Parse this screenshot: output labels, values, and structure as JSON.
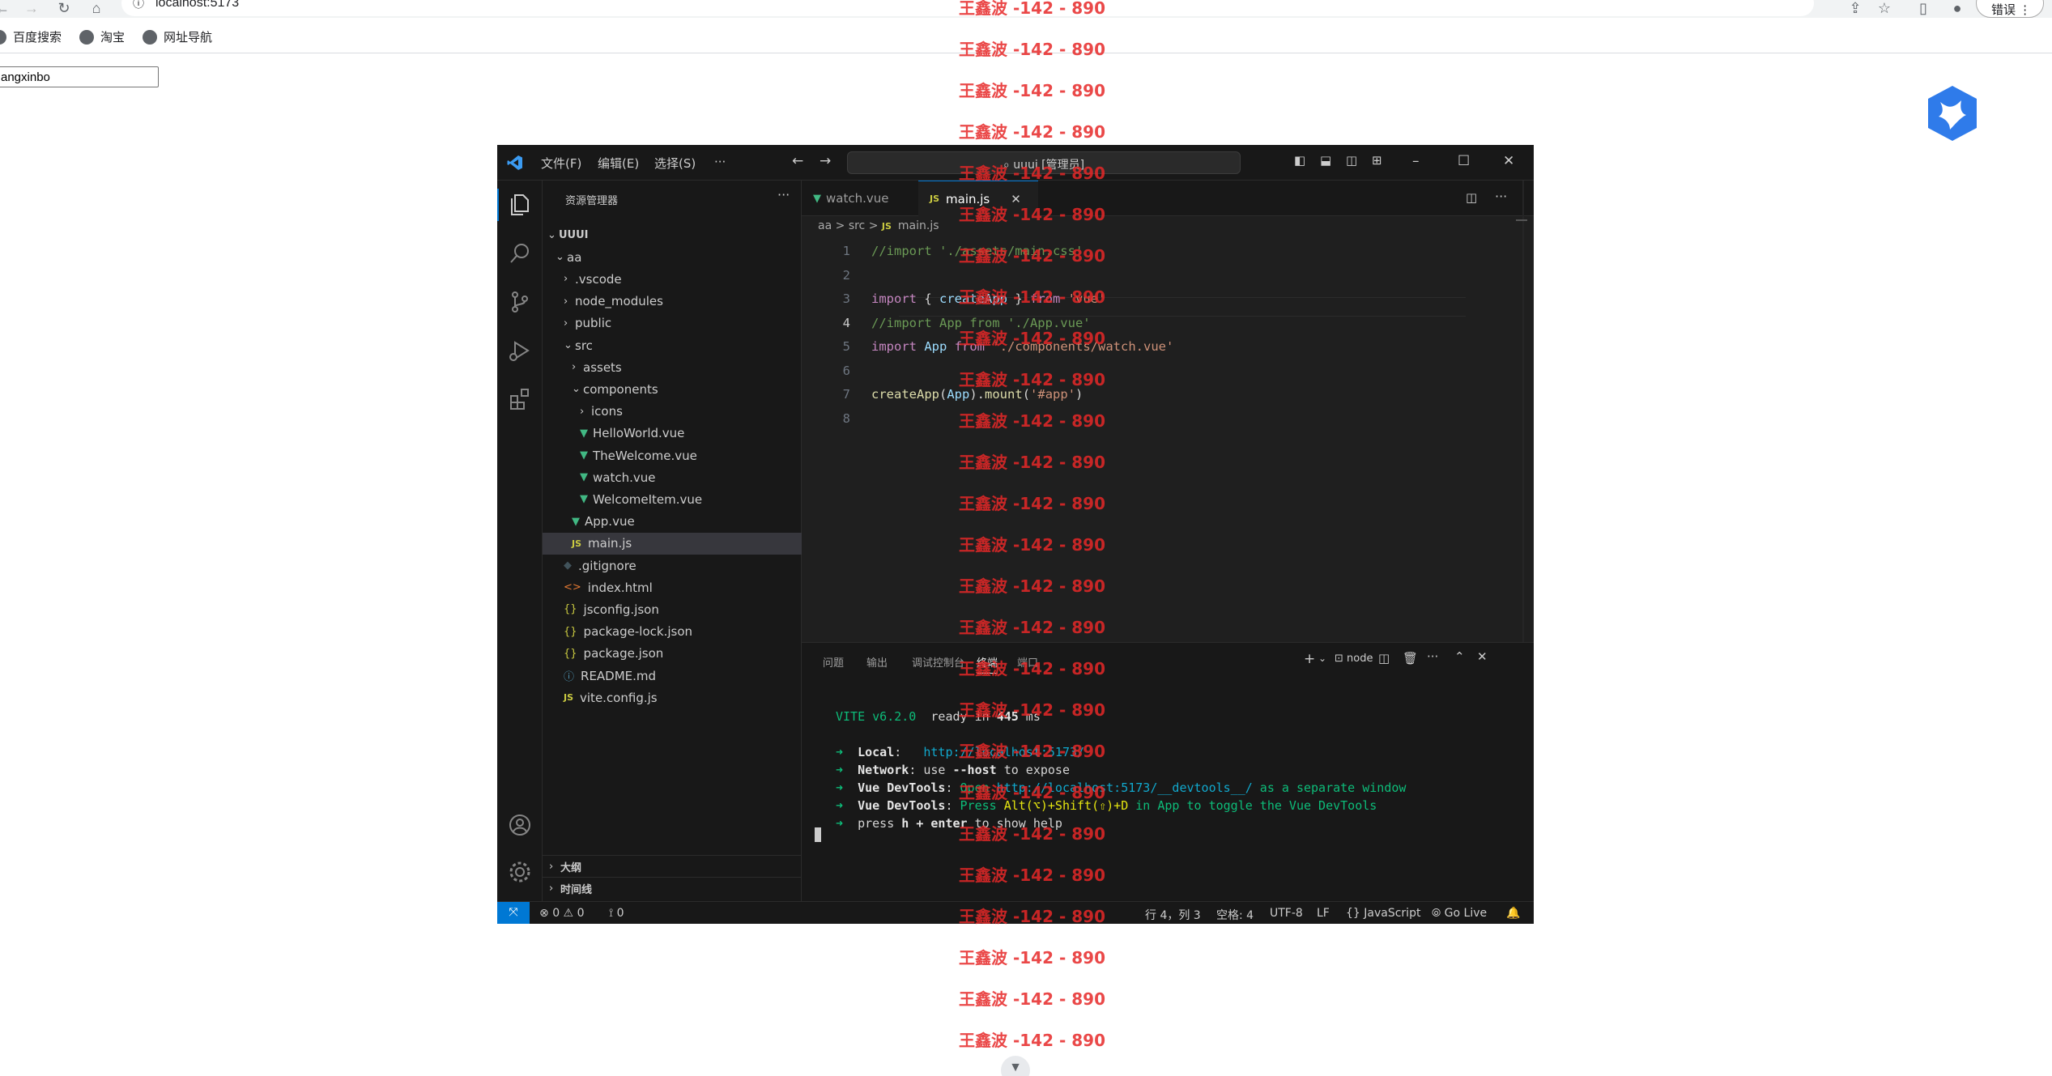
{
  "browser": {
    "url": "localhost:5173",
    "error_pill": "错误",
    "bookmarks": [
      "百度搜索",
      "淘宝",
      "网址导航"
    ],
    "name_input_value": "angxinbo",
    "scroll_down_icon": "chevron-down-icon"
  },
  "vscode": {
    "menus": [
      "文件(F)",
      "编辑(E)",
      "选择(S)",
      "···"
    ],
    "command_center": "uuui [管理员]",
    "explorer_title": "资源管理器",
    "tree": [
      {
        "label": "UUUI",
        "type": "root"
      },
      {
        "label": "aa",
        "type": "folder-open"
      },
      {
        "label": ".vscode",
        "type": "folder"
      },
      {
        "label": "node_modules",
        "type": "folder"
      },
      {
        "label": "public",
        "type": "folder"
      },
      {
        "label": "src",
        "type": "folder-open"
      },
      {
        "label": "assets",
        "type": "folder"
      },
      {
        "label": "components",
        "type": "folder-open"
      },
      {
        "label": "icons",
        "type": "folder"
      },
      {
        "label": "HelloWorld.vue",
        "type": "vue"
      },
      {
        "label": "TheWelcome.vue",
        "type": "vue"
      },
      {
        "label": "watch.vue",
        "type": "vue"
      },
      {
        "label": "WelcomeItem.vue",
        "type": "vue"
      },
      {
        "label": "App.vue",
        "type": "vue"
      },
      {
        "label": "main.js",
        "type": "js"
      },
      {
        "label": ".gitignore",
        "type": "git"
      },
      {
        "label": "index.html",
        "type": "html"
      },
      {
        "label": "jsconfig.json",
        "type": "json"
      },
      {
        "label": "package-lock.json",
        "type": "json"
      },
      {
        "label": "package.json",
        "type": "json"
      },
      {
        "label": "README.md",
        "type": "info"
      },
      {
        "label": "vite.config.js",
        "type": "js"
      }
    ],
    "outline_label": "大纲",
    "timeline_label": "时间线",
    "tabs": [
      {
        "label": "watch.vue"
      },
      {
        "label": "main.js"
      }
    ],
    "breadcrumb": [
      "aa",
      ">",
      "src",
      ">",
      "JS",
      "main.js"
    ],
    "code_lines": [
      {
        "n": "1",
        "parts": [
          [
            "cm",
            "//import './assets/main.css'"
          ]
        ]
      },
      {
        "n": "2",
        "parts": []
      },
      {
        "n": "3",
        "parts": [
          [
            "kw",
            "import"
          ],
          [
            "pl",
            " { "
          ],
          [
            "var",
            "createApp"
          ],
          [
            "pl",
            " } "
          ],
          [
            "kw",
            "from"
          ],
          [
            "pl",
            " "
          ],
          [
            "str",
            "'vue'"
          ]
        ]
      },
      {
        "n": "4",
        "parts": [
          [
            "cm",
            "//import App from './App.vue'"
          ]
        ]
      },
      {
        "n": "5",
        "parts": [
          [
            "kw",
            "import"
          ],
          [
            "pl",
            " "
          ],
          [
            "var",
            "App"
          ],
          [
            "pl",
            " "
          ],
          [
            "kw",
            "from"
          ],
          [
            "pl",
            " "
          ],
          [
            "str",
            "'./components/watch.vue'"
          ]
        ]
      },
      {
        "n": "6",
        "parts": []
      },
      {
        "n": "7",
        "parts": [
          [
            "fn",
            "createApp"
          ],
          [
            "pl",
            "("
          ],
          [
            "var",
            "App"
          ],
          [
            "pl",
            ")."
          ],
          [
            "fn",
            "mount"
          ],
          [
            "pl",
            "("
          ],
          [
            "str",
            "'#app'"
          ],
          [
            "pl",
            ")"
          ]
        ]
      },
      {
        "n": "8",
        "parts": []
      }
    ],
    "panel_tabs": [
      "问题",
      "输出",
      "调试控制台",
      "终端",
      "端口"
    ],
    "terminal_shell": "node",
    "terminal": [
      [
        [
          "g",
          "VITE"
        ],
        [
          "g",
          " v6.2.0"
        ],
        [
          "pl",
          "  ready in "
        ],
        [
          "b",
          "445"
        ],
        [
          "pl",
          " ms"
        ]
      ],
      [],
      [
        [
          "g",
          "➜"
        ],
        [
          "b",
          "  Local"
        ],
        [
          "pl",
          ":   "
        ],
        [
          "c",
          "http://localhost:5173/"
        ]
      ],
      [
        [
          "g",
          "➜"
        ],
        [
          "b",
          "  Network"
        ],
        [
          "pl",
          ": use "
        ],
        [
          "b",
          "--host"
        ],
        [
          "pl",
          " to expose"
        ]
      ],
      [
        [
          "g",
          "➜"
        ],
        [
          "b",
          "  Vue DevTools"
        ],
        [
          "pl",
          ": "
        ],
        [
          "g",
          "Open "
        ],
        [
          "c",
          "http://localhost:5173/__devtools__/"
        ],
        [
          "g",
          " as a separate window"
        ]
      ],
      [
        [
          "g",
          "➜"
        ],
        [
          "b",
          "  Vue DevTools"
        ],
        [
          "pl",
          ": "
        ],
        [
          "g",
          "Press "
        ],
        [
          "y",
          "Alt(⌥)+Shift(⇧)+D"
        ],
        [
          "g",
          " in App to toggle the Vue DevTools"
        ]
      ],
      [
        [
          "g",
          "➜"
        ],
        [
          "pl",
          "  press "
        ],
        [
          "b",
          "h + enter"
        ],
        [
          "pl",
          " to show help"
        ]
      ]
    ],
    "status": {
      "errors": "0",
      "warnings": "0",
      "ports": "0",
      "position": "行 4，列 3",
      "spaces": "空格: 4",
      "encoding": "UTF-8",
      "eol": "LF",
      "language": "JavaScript",
      "golive": "Go Live"
    }
  },
  "watermark_text": "王鑫波 -142 - 890",
  "colors": {
    "accent": "#0078d4",
    "watermark": "#e62828",
    "vue": "#41b883"
  }
}
